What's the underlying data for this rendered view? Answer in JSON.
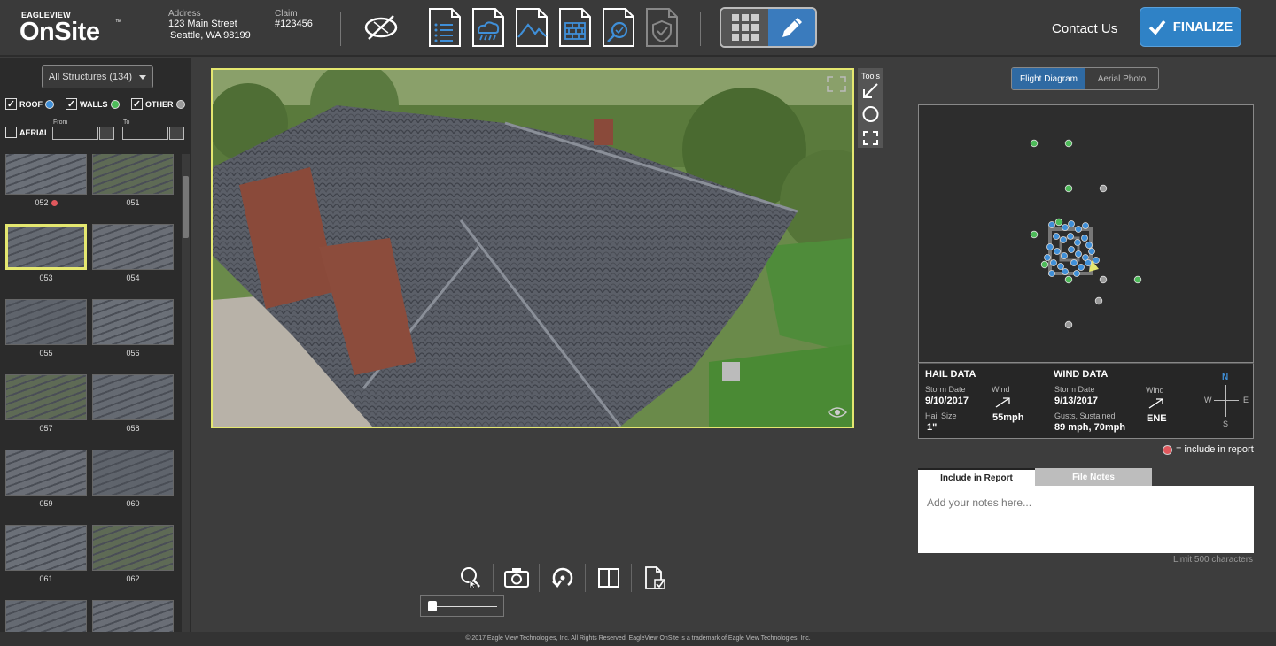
{
  "header": {
    "brand_small": "EAGLEVIEW",
    "brand_big": "OnSite",
    "brand_tm": "™",
    "address_label": "Address",
    "address_line1": "123 Main Street",
    "address_line2": "Seattle, WA 98199",
    "claim_label": "Claim",
    "claim_value": "#123456",
    "contact_label": "Contact Us",
    "finalize_label": "FINALIZE",
    "nav_icons": [
      "compass-icon",
      "list-report-icon",
      "weather-report-icon",
      "roof-report-icon",
      "wall-report-icon",
      "inspection-report-icon",
      "verified-report-icon"
    ]
  },
  "sidebar": {
    "structures_dropdown": "All Structures (134)",
    "filters": [
      {
        "label": "ROOF",
        "checked": true,
        "color": "#3f8fd8"
      },
      {
        "label": "WALLS",
        "checked": true,
        "color": "#4dbb59"
      },
      {
        "label": "OTHER",
        "checked": true,
        "color": "#9a9a9a"
      },
      {
        "label": "AERIAL",
        "checked": false
      }
    ],
    "from_label": "From",
    "to_label": "To",
    "thumbnails": [
      {
        "label": "052",
        "flag": true
      },
      {
        "label": "051"
      },
      {
        "label": "053",
        "selected": true
      },
      {
        "label": "054"
      },
      {
        "label": "055"
      },
      {
        "label": "056"
      },
      {
        "label": "057"
      },
      {
        "label": "058"
      },
      {
        "label": "059"
      },
      {
        "label": "060"
      },
      {
        "label": "061"
      },
      {
        "label": "062"
      },
      {
        "label": ""
      },
      {
        "label": ""
      }
    ]
  },
  "tools": {
    "label": "Tools"
  },
  "right": {
    "flight_diagram": "Flight Diagram",
    "aerial_photo": "Aerial Photo",
    "hail": {
      "title": "HAIL DATA",
      "storm_date_label": "Storm Date",
      "storm_date": "9/10/2017",
      "hail_size_label": "Hail Size",
      "hail_size": "1\"",
      "wind_label": "Wind",
      "wind_value": "55mph"
    },
    "wind": {
      "title": "WIND DATA",
      "storm_date_label": "Storm Date",
      "storm_date": "9/13/2017",
      "gusts_label": "Gusts, Sustained",
      "gusts_value": "89 mph, 70mph",
      "wind_label": "Wind",
      "wind_value": "ENE"
    },
    "compass": {
      "n": "N",
      "e": "E",
      "s": "S",
      "w": "W"
    },
    "legend": "= include in report",
    "tab_include": "Include in Report",
    "tab_notes": "File Notes",
    "notes_placeholder": "Add your notes here...",
    "limit": "Limit 500 characters"
  },
  "footer": "© 2017 Eagle View Technologies, Inc. All Rights Reserved. EagleView OnSite is a trademark of Eagle View Technologies, Inc."
}
